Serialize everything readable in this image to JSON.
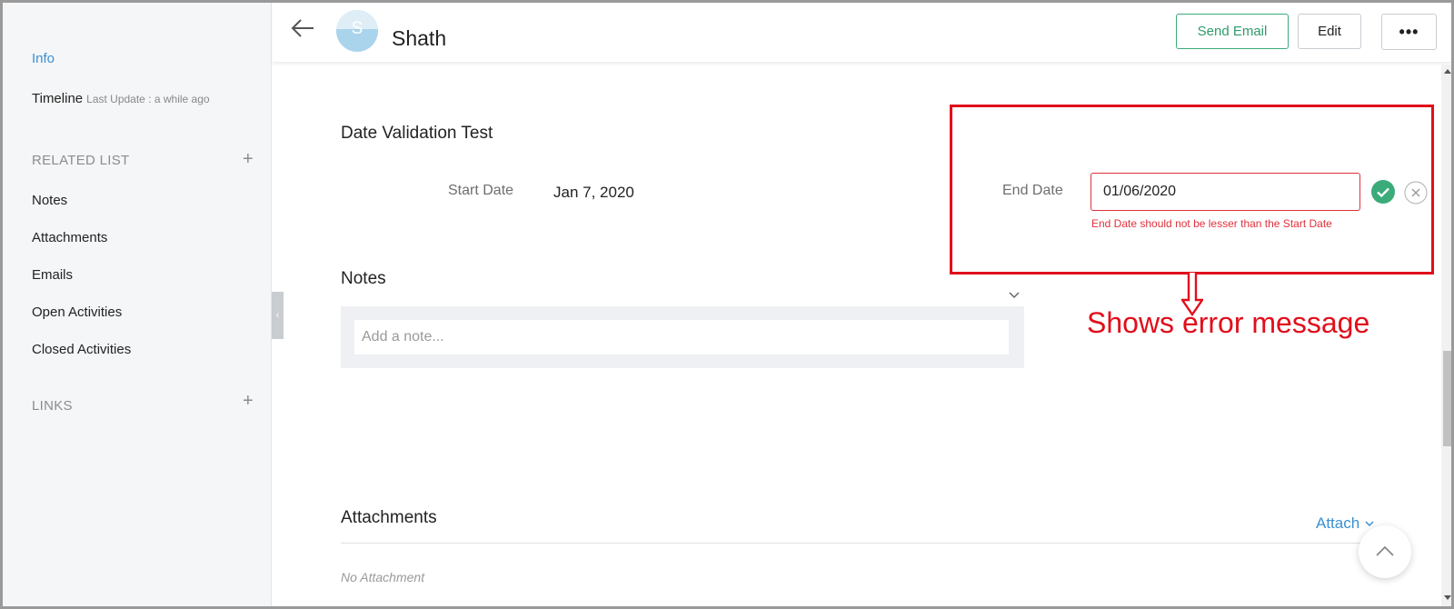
{
  "sidebar": {
    "info": "Info",
    "timeline": "Timeline",
    "timeline_sub": "Last Update : a while ago",
    "related_list_heading": "RELATED LIST",
    "related_items": [
      "Notes",
      "Attachments",
      "Emails",
      "Open Activities",
      "Closed Activities"
    ],
    "links_heading": "LINKS"
  },
  "header": {
    "avatar_letter": "S",
    "record_name": "Shath",
    "send_email_label": "Send Email",
    "edit_label": "Edit",
    "more_label": "•••"
  },
  "record": {
    "section_title": "Date Validation Test",
    "start_date_label": "Start Date",
    "start_date_value": "Jan 7, 2020",
    "end_date_label": "End Date",
    "end_date_value": "01/06/2020",
    "error_message": "End  Date should not be lesser than the Start Date"
  },
  "annotation": {
    "text": "Shows error message"
  },
  "notes": {
    "title": "Notes",
    "placeholder": "Add a note..."
  },
  "attachments": {
    "title": "Attachments",
    "attach_label": "Attach",
    "empty_text": "No Attachment"
  },
  "colors": {
    "accent_blue": "#3a8fd1",
    "email_green": "#2f9a6b",
    "error_red": "#e0313b",
    "annotation_red": "#e10e1b"
  }
}
